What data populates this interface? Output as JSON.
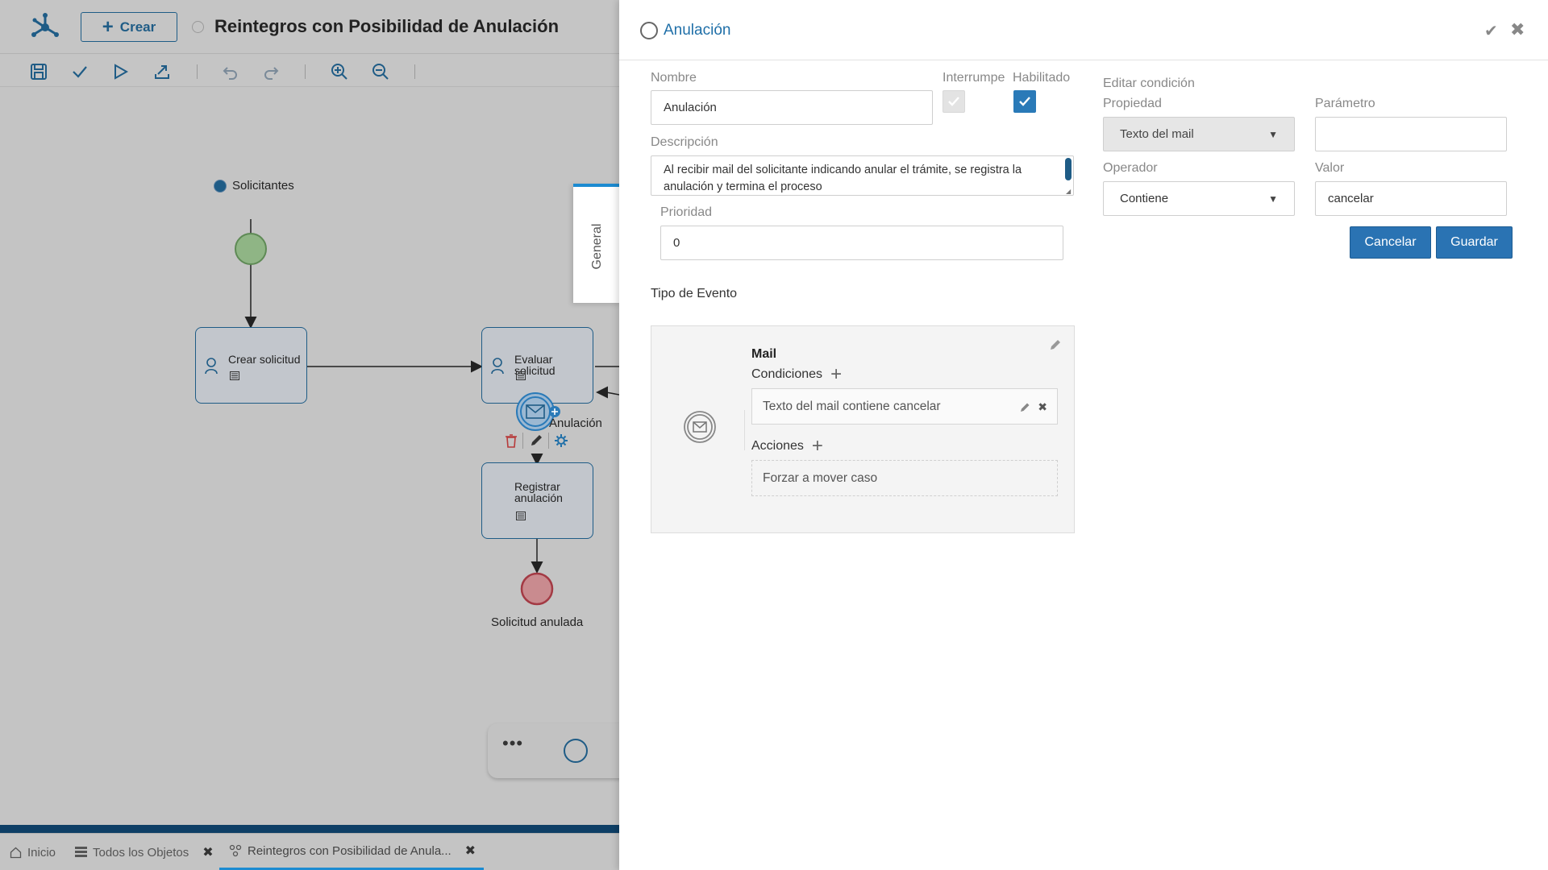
{
  "header": {
    "create_label": "Crear",
    "diagram_title": "Reintegros con Posibilidad de Anulación"
  },
  "toolbar": {
    "icons": [
      "save-icon",
      "check-icon",
      "play-icon",
      "export-icon",
      "undo-icon",
      "redo-icon",
      "zoom-in-icon",
      "zoom-out-icon"
    ]
  },
  "diagram": {
    "lane": "Solicitantes",
    "tasks": {
      "crear": "Crear solicitud",
      "evaluar": "Evaluar solicitud",
      "registrar_line1": "Registrar",
      "registrar_line2": "anulación"
    },
    "boundary_event": "Anulación",
    "end_event": "Solicitud anulada",
    "side_tab": "General"
  },
  "bottom_tabs": {
    "home": "Inicio",
    "all_objects": "Todos los Objetos",
    "current": "Reintegros con Posibilidad de Anula..."
  },
  "panel": {
    "title": "Anulación",
    "nombre_label": "Nombre",
    "nombre_value": "Anulación",
    "interrumpe_label": "Interrumpe",
    "habilitado_label": "Habilitado",
    "descripcion_label": "Descripción",
    "descripcion_value": "Al recibir mail del solicitante indicando anular el trámite, se registra la anulación y termina el proceso",
    "prioridad_label": "Prioridad",
    "prioridad_value": "0",
    "tipo_evento_label": "Tipo de Evento",
    "event_type": "Mail",
    "condiciones_label": "Condiciones",
    "condition_1": "Texto del mail contiene cancelar",
    "acciones_label": "Acciones",
    "action_1": "Forzar a mover caso",
    "editar_condicion_label": "Editar condición",
    "propiedad_label": "Propiedad",
    "propiedad_value": "Texto del mail",
    "parametro_label": "Parámetro",
    "parametro_value": "",
    "operador_label": "Operador",
    "operador_value": "Contiene",
    "valor_label": "Valor",
    "valor_value": "cancelar",
    "cancelar_label": "Cancelar",
    "guardar_label": "Guardar"
  },
  "colors": {
    "accent": "#2a73b3",
    "brand_dark": "#1f5c86",
    "tab_highlight": "#1c8bd1",
    "start_event": "#8fb585",
    "end_event": "#c98b8f"
  }
}
